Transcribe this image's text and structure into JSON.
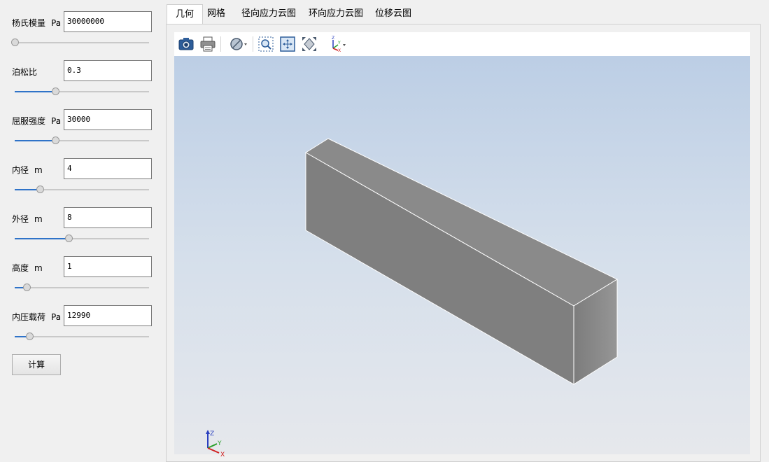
{
  "params": [
    {
      "label": "杨氏模量",
      "unit": "Pa",
      "value": "30000000",
      "slider_fraction": 0.0
    },
    {
      "label": "泊松比",
      "unit": "",
      "value": "0.3",
      "slider_fraction": 0.3
    },
    {
      "label": "屈服强度",
      "unit": "Pa",
      "value": "30000",
      "slider_fraction": 0.3
    },
    {
      "label": "内径",
      "unit": "m",
      "value": "4",
      "slider_fraction": 0.19
    },
    {
      "label": "外径",
      "unit": "m",
      "value": "8",
      "slider_fraction": 0.4
    },
    {
      "label": "高度",
      "unit": "m",
      "value": "1",
      "slider_fraction": 0.09
    },
    {
      "label": "内压载荷",
      "unit": "Pa",
      "value": "12990",
      "slider_fraction": 0.11
    }
  ],
  "calc_button": "计算",
  "tabs": [
    "几何",
    "网格",
    "径向应力云图",
    "环向应力云图",
    "位移云图"
  ],
  "active_tab": "几何",
  "toolbar": [
    {
      "icon": "camera-icon"
    },
    {
      "icon": "print-icon"
    },
    {
      "icon": "view-style-icon"
    },
    {
      "icon": "zoom-box-icon"
    },
    {
      "icon": "fit-view-icon"
    },
    {
      "icon": "reset-view-icon"
    },
    {
      "icon": "axis-orientation-icon"
    }
  ],
  "axis_labels": {
    "x": "X",
    "y": "Y",
    "z": "Z"
  },
  "colors": {
    "slider_fill": "#2f73c8",
    "model_front": "#7f7f7f",
    "model_top": "#909090",
    "model_side": "#8a8a8a"
  }
}
